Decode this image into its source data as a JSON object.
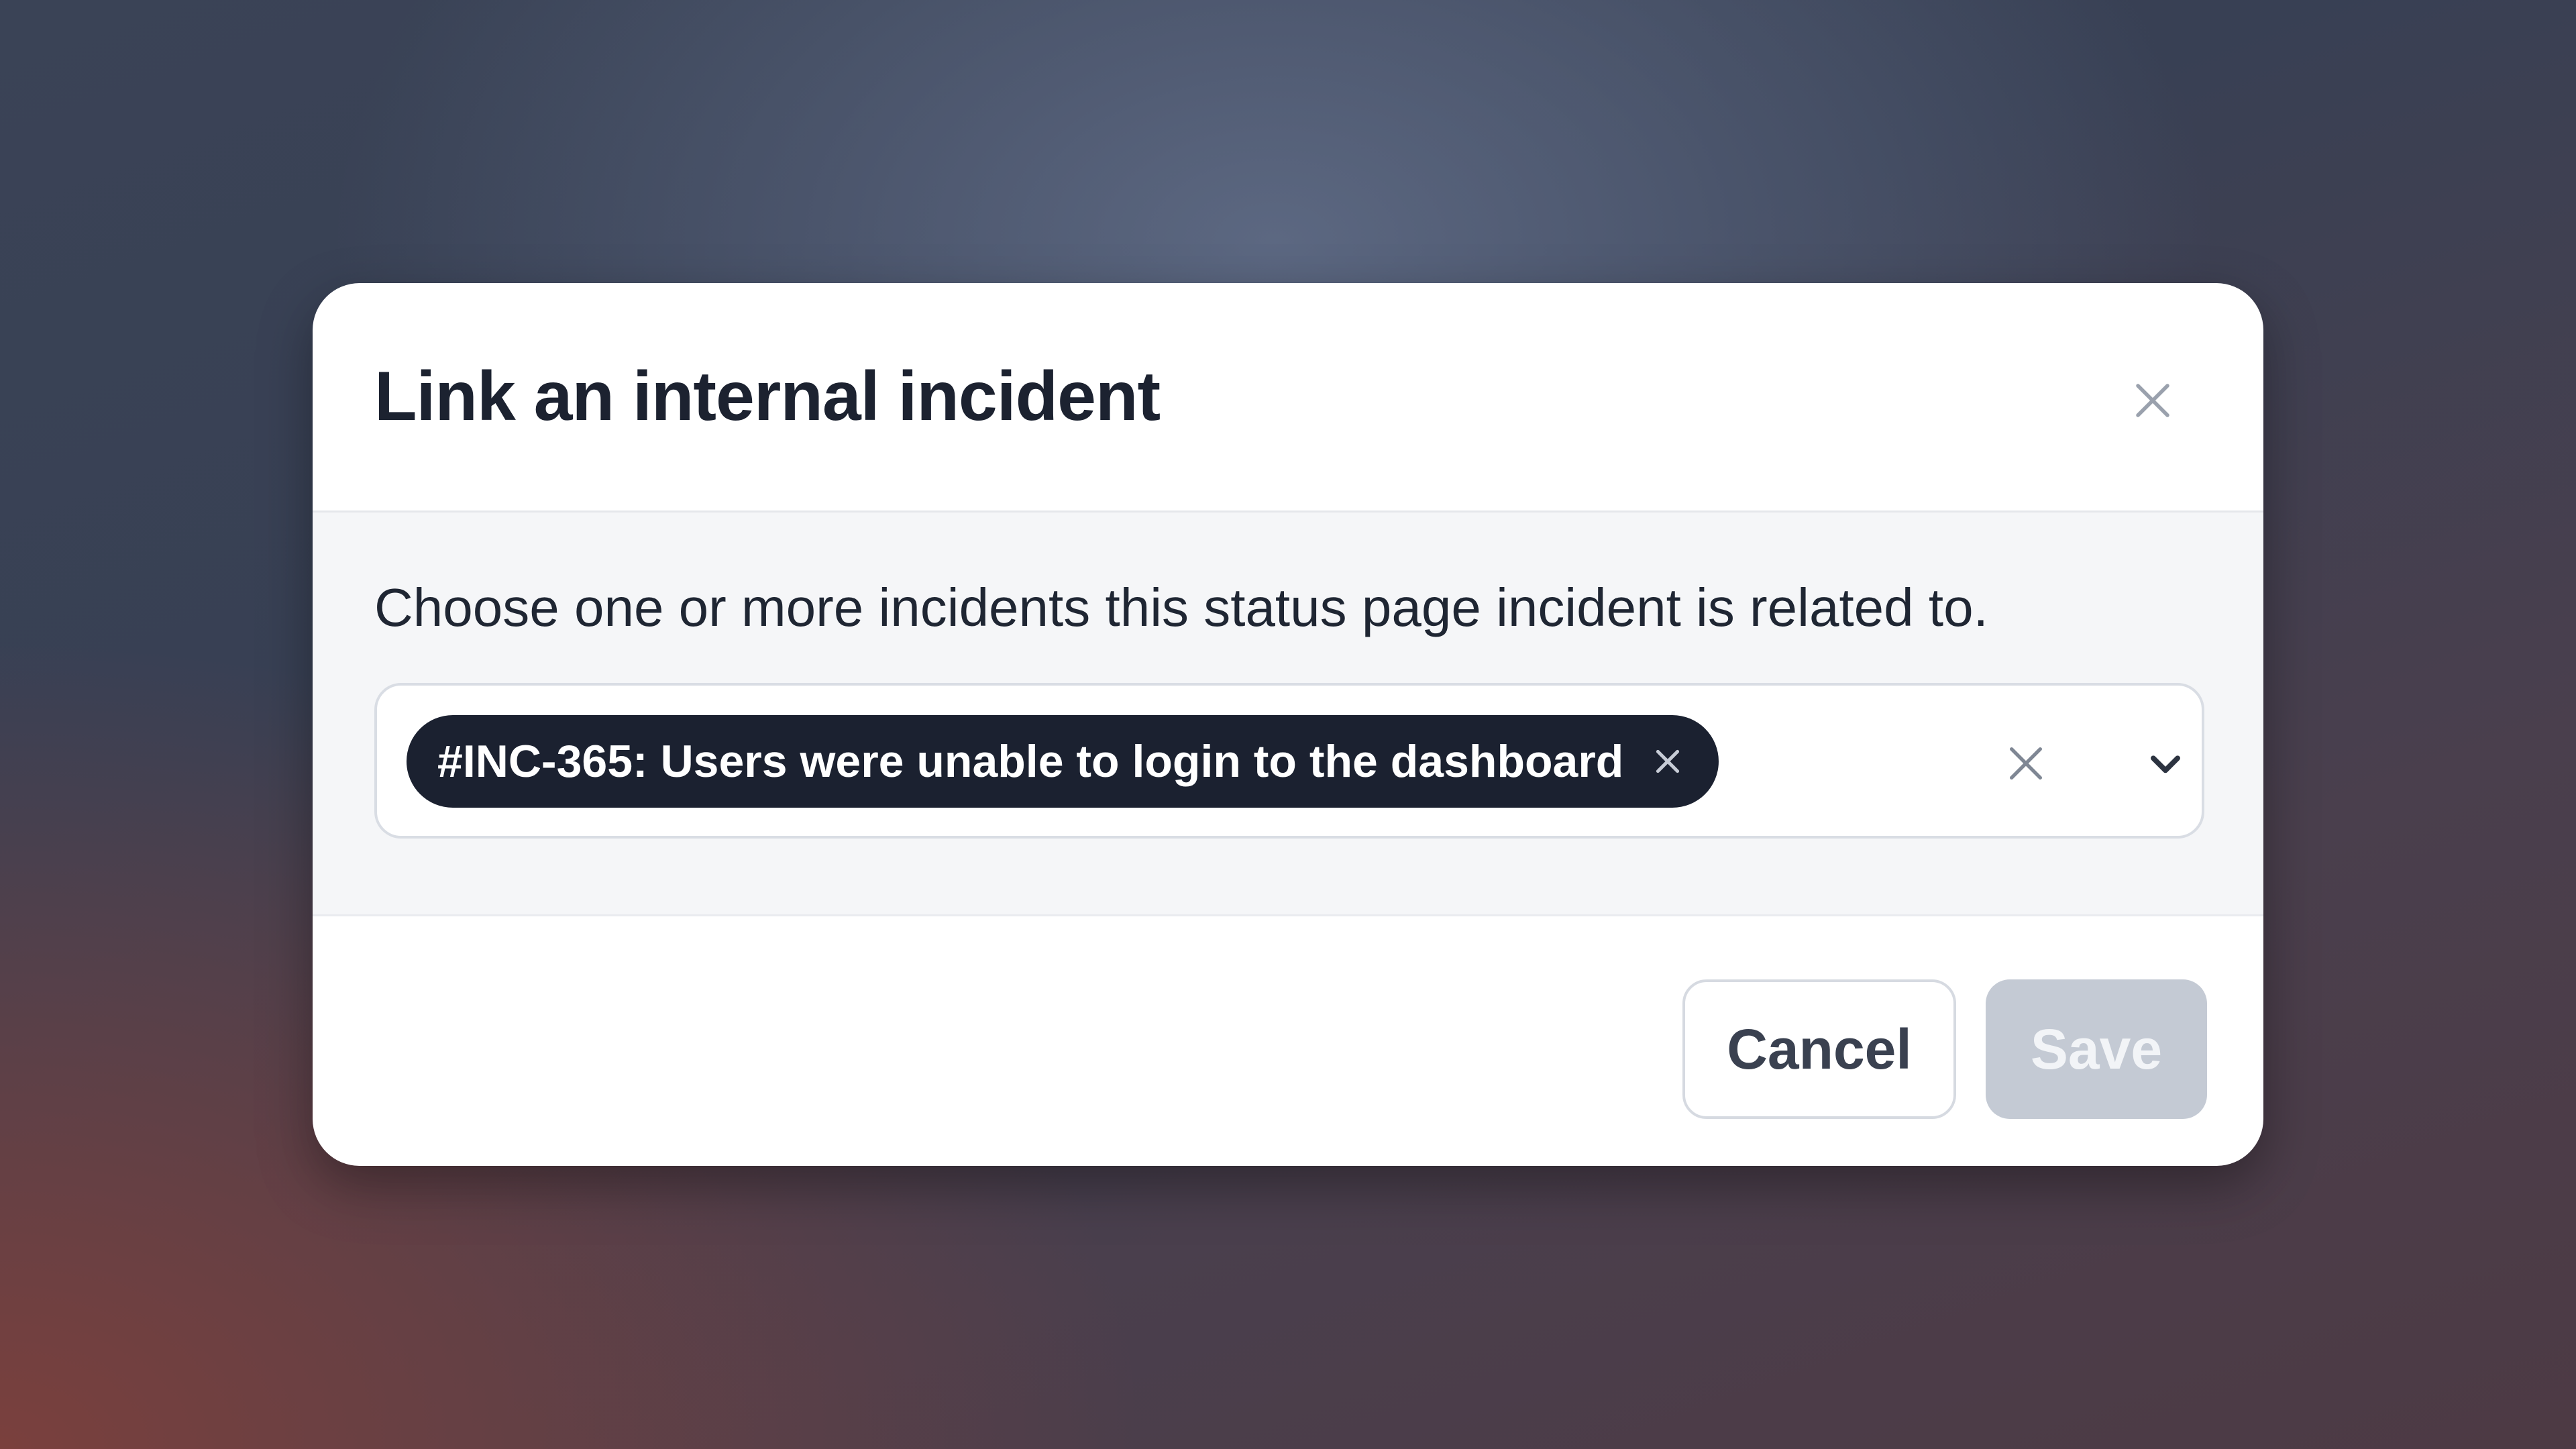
{
  "dialog": {
    "title": "Link an internal incident",
    "close_icon": "close-icon"
  },
  "body": {
    "description": "Choose one or more incidents this status page incident is related to.",
    "select": {
      "selected": [
        {
          "label": "#INC-365: Users were unable to login to the dashboard",
          "remove_icon": "x-icon"
        }
      ],
      "clear_icon": "x-icon",
      "dropdown_icon": "chevron-down-icon"
    }
  },
  "footer": {
    "cancel_label": "Cancel",
    "save_label": "Save",
    "save_disabled": true
  },
  "colors": {
    "chip_bg": "#1b2130",
    "save_disabled_bg": "#c4cad4",
    "title_text": "#1c2230"
  }
}
